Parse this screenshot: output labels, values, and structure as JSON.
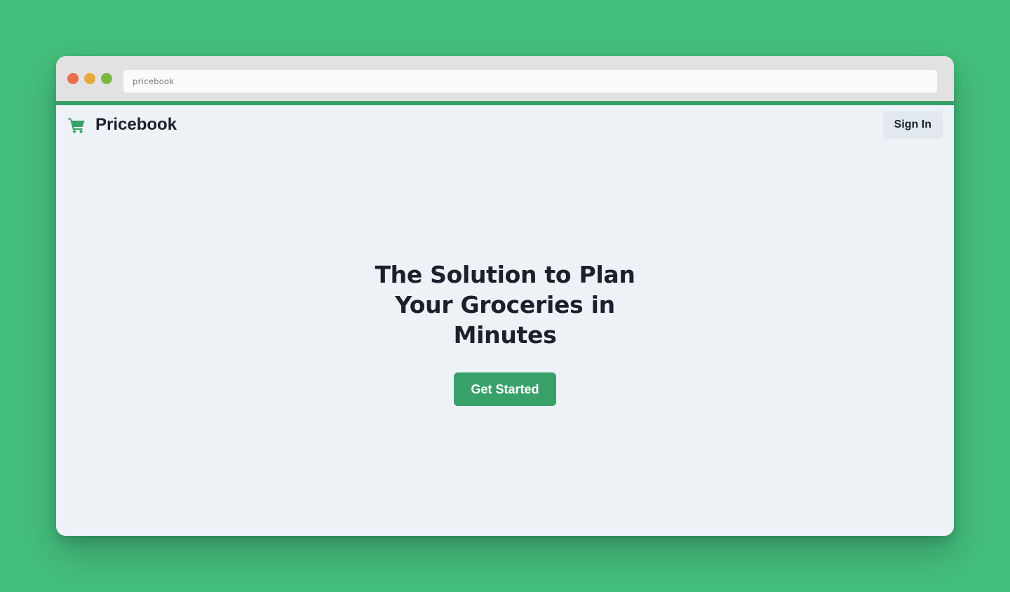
{
  "browser": {
    "address_text": "pricebook"
  },
  "nav": {
    "brand_name": "Pricebook",
    "brand_icon": "shopping-cart-icon",
    "signin_label": "Sign In"
  },
  "hero": {
    "title": "The Solution to Plan Your Groceries in Minutes",
    "cta_label": "Get Started"
  },
  "colors": {
    "background": "#44be7c",
    "accent": "#38a169",
    "page_background": "#edf2f7",
    "text": "#1a202c",
    "secondary_button": "#e2e8f0",
    "traffic_red": "#e8704c",
    "traffic_yellow": "#e7a93b",
    "traffic_green": "#7ab840"
  }
}
